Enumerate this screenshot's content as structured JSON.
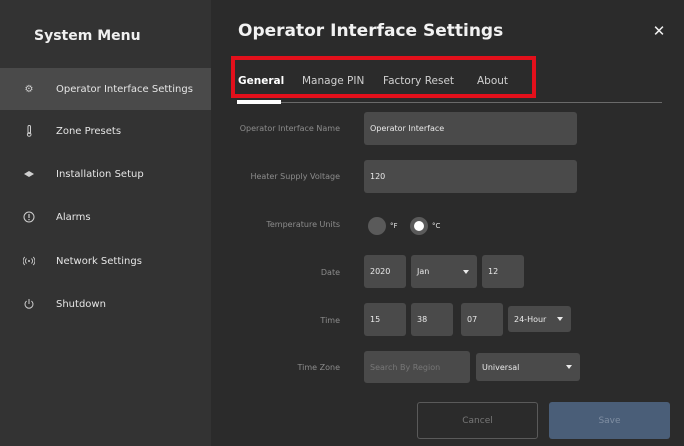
{
  "sidebar": {
    "title": "System Menu",
    "items": [
      {
        "label": "Operator Interface Settings",
        "icon": "gear-icon",
        "active": true
      },
      {
        "label": "Zone Presets",
        "icon": "thermometer-icon"
      },
      {
        "label": "Installation Setup",
        "icon": "wrench-icon"
      },
      {
        "label": "Alarms",
        "icon": "alert-icon"
      },
      {
        "label": "Network Settings",
        "icon": "wifi-icon"
      },
      {
        "label": "Shutdown",
        "icon": "power-icon"
      }
    ]
  },
  "header": {
    "title": "Operator Interface Settings",
    "close_icon": "close-icon"
  },
  "tabs": [
    {
      "label": "General",
      "active": true
    },
    {
      "label": "Manage PIN"
    },
    {
      "label": "Factory Reset"
    },
    {
      "label": "About"
    }
  ],
  "annotation": {
    "highlight_color": "#e3101b"
  },
  "form": {
    "name": {
      "label": "Operator Interface Name",
      "value": "Operator Interface"
    },
    "voltage": {
      "label": "Heater Supply Voltage",
      "value": "120"
    },
    "units": {
      "label": "Temperature Units",
      "options": [
        "°F",
        "°C"
      ],
      "selected": "°C"
    },
    "date": {
      "label": "Date",
      "year": "2020",
      "month": "Jan",
      "day": "12"
    },
    "time": {
      "label": "Time",
      "hour": "15",
      "minute": "38",
      "second": "07",
      "format": "24-Hour"
    },
    "timezone": {
      "label": "Time Zone",
      "search_placeholder": "Search By Region",
      "value": "Universal"
    }
  },
  "actions": {
    "cancel": "Cancel",
    "save": "Save"
  },
  "colors": {
    "sidebar_bg": "#333333",
    "main_bg": "#2b2b2b",
    "field_bg": "#4a4a4a",
    "save_bg": "#4a5e78"
  }
}
